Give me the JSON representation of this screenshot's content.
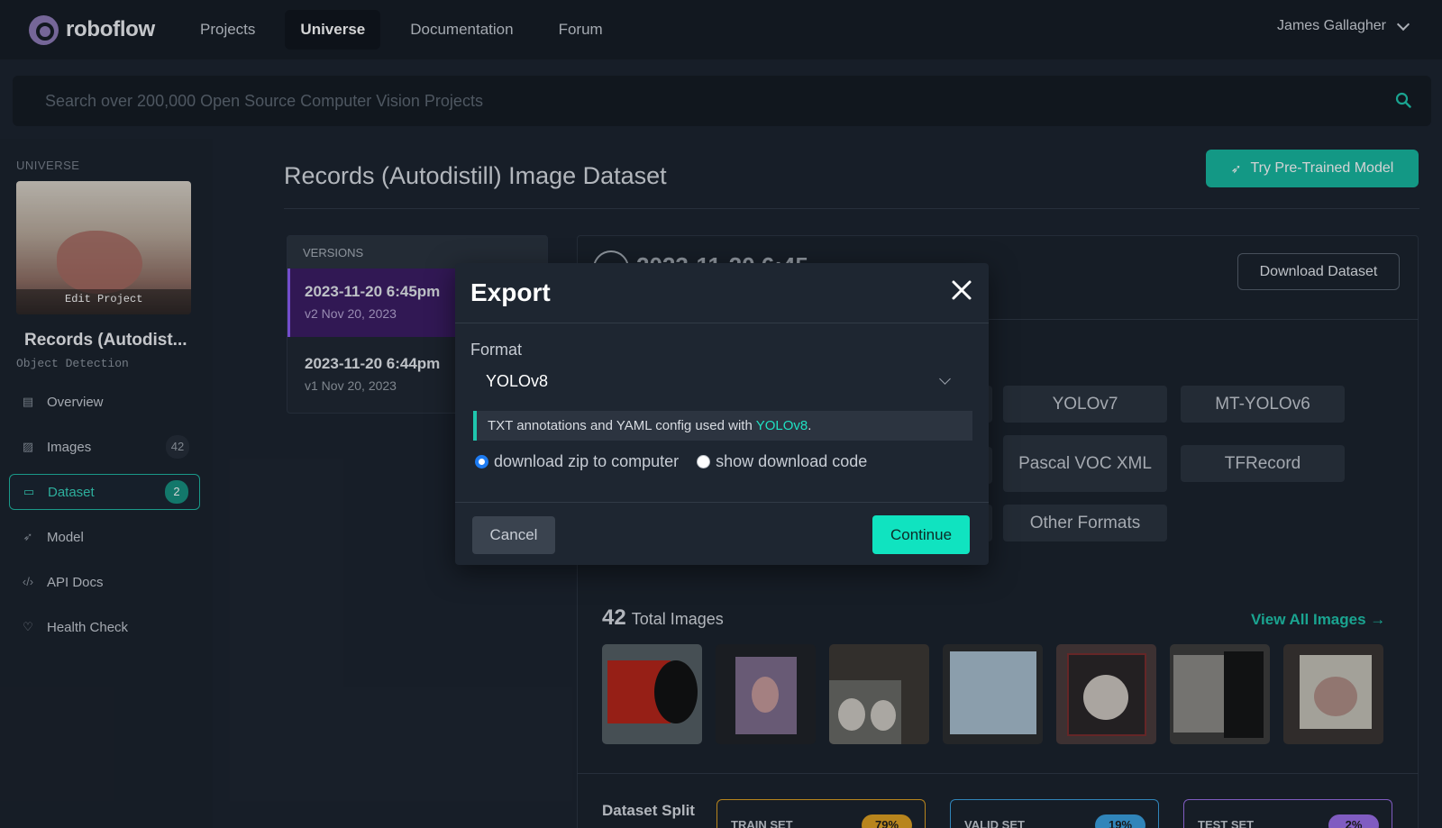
{
  "brand": {
    "name": "roboflow"
  },
  "nav": {
    "links": [
      "Projects",
      "Universe",
      "Documentation",
      "Forum"
    ],
    "active": "Universe",
    "user": "James Gallagher"
  },
  "search": {
    "placeholder": "Search over 200,000 Open Source Computer Vision Projects"
  },
  "sidebar": {
    "section_label": "UNIVERSE",
    "edit_project": "Edit Project",
    "project_name": "Records (Autodist...",
    "project_type": "Object Detection",
    "items": [
      {
        "label": "Overview",
        "icon": "overview-icon"
      },
      {
        "label": "Images",
        "icon": "images-icon",
        "count": "42"
      },
      {
        "label": "Dataset",
        "icon": "dataset-icon",
        "count": "2",
        "active": true
      },
      {
        "label": "Model",
        "icon": "rocket-icon"
      },
      {
        "label": "API Docs",
        "icon": "code-icon"
      },
      {
        "label": "Health Check",
        "icon": "heart-icon"
      }
    ]
  },
  "main": {
    "title": "Records (Autodistill) Image Dataset",
    "try_button": "Try Pre-Trained Model",
    "versions_header": "VERSIONS",
    "versions": [
      {
        "date": "2023-11-20 6:45pm",
        "sub": "v2 Nov 20, 2023",
        "active": true
      },
      {
        "date": "2023-11-20 6:44pm",
        "sub": "v1 Nov 20, 2023"
      }
    ],
    "version_title_partial": "2023-11-20 6:45",
    "download_button": "Download Dataset",
    "formats": [
      "YOLOv7",
      "MT-YOLOv6",
      "Pascal VOC XML",
      "TFRecord",
      "Other Formats"
    ],
    "images": {
      "count": "42",
      "label": "Total Images",
      "view_all": "View All Images"
    },
    "split": {
      "label": "Dataset Split",
      "sets": [
        {
          "name": "TRAIN SET",
          "pct": "79%",
          "color": "#e0a020"
        },
        {
          "name": "VALID SET",
          "pct": "19%",
          "color": "#3aa0e0"
        },
        {
          "name": "TEST SET",
          "pct": "2%",
          "color": "#9b6ee8"
        }
      ]
    }
  },
  "modal": {
    "title": "Export",
    "format_label": "Format",
    "format_value": "YOLOv8",
    "info_prefix": "TXT annotations and YAML config used with ",
    "info_highlight": "YOLOv8",
    "info_suffix": ".",
    "options": [
      "download zip to computer",
      "show download code"
    ],
    "selected_option": "download zip to computer",
    "cancel": "Cancel",
    "continue": "Continue"
  },
  "colors": {
    "accent": "#17b79f",
    "continue": "#10e3c0",
    "active_version": "#3b1b63"
  }
}
